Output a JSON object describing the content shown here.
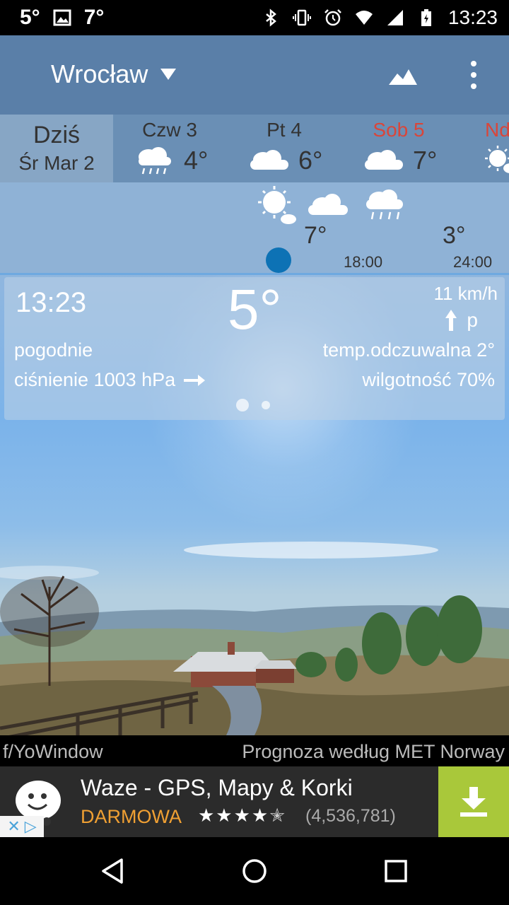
{
  "status_bar": {
    "left_temp": "5°",
    "left_temp2": "7°",
    "time": "13:23",
    "icons": [
      "temperature-notification-icon",
      "image-icon",
      "bluetooth-icon",
      "vibrate-icon",
      "alarm-icon",
      "wifi-icon",
      "signal-icon",
      "battery-icon"
    ]
  },
  "header": {
    "city": "Wrocław",
    "icons": [
      "landscape-icon",
      "more-vert-icon"
    ]
  },
  "days": [
    {
      "line1": "Dziś",
      "line2": "Śr Mar 2",
      "selected": true
    },
    {
      "name": "Czw 3",
      "temp": "4°",
      "icon": "rain-cloud-icon",
      "weekend": false
    },
    {
      "name": "Pt 4",
      "temp": "6°",
      "icon": "cloud-icon",
      "weekend": false
    },
    {
      "name": "Sob 5",
      "temp": "7°",
      "icon": "cloud-icon",
      "weekend": true
    },
    {
      "name": "Nd",
      "temp": "",
      "icon": "sun-cloud-icon",
      "weekend": true
    }
  ],
  "hourly": {
    "temps": [
      "7°",
      "3°"
    ],
    "times": [
      "18:00",
      "24:00"
    ],
    "icons": [
      "sun-cloud-icon",
      "cloud-icon",
      "rain-cloud-icon"
    ]
  },
  "current": {
    "time": "13:23",
    "temp": "5°",
    "wind": "11 km/h",
    "wind_dir": "p",
    "condition": "pogodnie",
    "pressure": "ciśnienie 1003 hPa",
    "feels_like": "temp.odczuwalna 2°",
    "humidity": "wilgotność 70%"
  },
  "attribution": {
    "left": "f/YoWindow",
    "right": "Prognoza według MET Norway"
  },
  "ad": {
    "title": "Waze - GPS, Mapy & Korki",
    "price": "DARMOWA",
    "rating": 4.5,
    "reviews": "(4,536,781)"
  },
  "colors": {
    "accent_blue": "#0d72b5",
    "weekend_red": "#d9463a",
    "ad_orange": "#f0a033",
    "ad_green": "#a9c83a"
  }
}
